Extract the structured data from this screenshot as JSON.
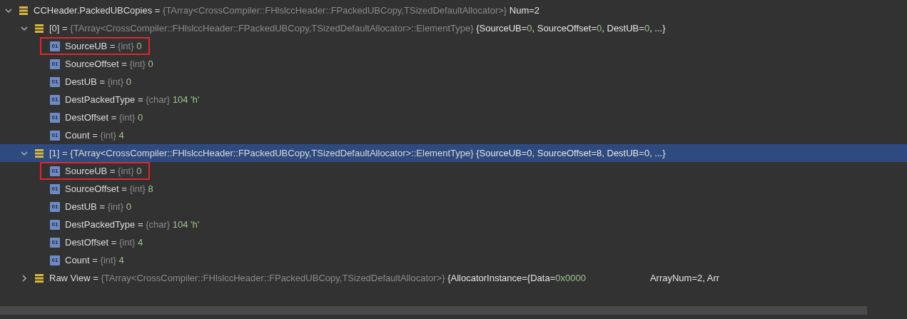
{
  "variables": [
    {
      "kind": "group",
      "name": "CCHeader.PackedUBCopies",
      "equals": "=",
      "type": "{TArray<CrossCompiler::FHlslccHeader::FPackedUBCopy,TSizedDefaultAllocator>}",
      "value": [
        {
          "text": "Num=2",
          "kind": "plain"
        }
      ],
      "expanded": true,
      "selected": false,
      "children": [
        {
          "kind": "group",
          "name": "[0]",
          "equals": "=",
          "type": "{TArray<CrossCompiler::FHlslccHeader::FPackedUBCopy,TSizedDefaultAllocator>::ElementType}",
          "value": [
            {
              "text": "{SourceUB=",
              "kind": "plain"
            },
            {
              "text": "0",
              "kind": "number"
            },
            {
              "text": ", SourceOffset=",
              "kind": "plain"
            },
            {
              "text": "0",
              "kind": "number"
            },
            {
              "text": ", DestUB=",
              "kind": "plain"
            },
            {
              "text": "0",
              "kind": "number"
            },
            {
              "text": ", ...}",
              "kind": "plain"
            }
          ],
          "expanded": true,
          "selected": false,
          "children": [
            {
              "kind": "leaf",
              "badge": "01",
              "name": "SourceUB",
              "equals": "=",
              "type": "{int}",
              "value": [
                {
                  "text": "0",
                  "kind": "number"
                }
              ],
              "selected": false,
              "highlighted": true
            },
            {
              "kind": "leaf",
              "badge": "01",
              "name": "SourceOffset",
              "equals": "=",
              "type": "{int}",
              "value": [
                {
                  "text": "0",
                  "kind": "number"
                }
              ],
              "selected": false,
              "highlighted": false
            },
            {
              "kind": "leaf",
              "badge": "01",
              "name": "DestUB",
              "equals": "=",
              "type": "{int}",
              "value": [
                {
                  "text": "0",
                  "kind": "number"
                }
              ],
              "selected": false,
              "highlighted": false
            },
            {
              "kind": "leaf",
              "badge": "01",
              "name": "DestPackedType",
              "equals": "=",
              "type": "{char}",
              "value": [
                {
                  "text": "104 'h'",
                  "kind": "number"
                }
              ],
              "selected": false,
              "highlighted": false
            },
            {
              "kind": "leaf",
              "badge": "01",
              "name": "DestOffset",
              "equals": "=",
              "type": "{int}",
              "value": [
                {
                  "text": "0",
                  "kind": "number"
                }
              ],
              "selected": false,
              "highlighted": false
            },
            {
              "kind": "leaf",
              "badge": "01",
              "name": "Count",
              "equals": "=",
              "type": "{int}",
              "value": [
                {
                  "text": "4",
                  "kind": "number"
                }
              ],
              "selected": false,
              "highlighted": false
            }
          ]
        },
        {
          "kind": "group",
          "name": "[1]",
          "equals": "=",
          "type": "{TArray<CrossCompiler::FHlslccHeader::FPackedUBCopy,TSizedDefaultAllocator>::ElementType}",
          "value": [
            {
              "text": "{SourceUB=",
              "kind": "plain"
            },
            {
              "text": "0",
              "kind": "number"
            },
            {
              "text": ", SourceOffset=",
              "kind": "plain"
            },
            {
              "text": "8",
              "kind": "number"
            },
            {
              "text": ", DestUB=",
              "kind": "plain"
            },
            {
              "text": "0",
              "kind": "number"
            },
            {
              "text": ", ...}",
              "kind": "plain"
            }
          ],
          "expanded": true,
          "selected": true,
          "children": [
            {
              "kind": "leaf",
              "badge": "01",
              "name": "SourceUB",
              "equals": "=",
              "type": "{int}",
              "value": [
                {
                  "text": "0",
                  "kind": "number"
                }
              ],
              "selected": false,
              "highlighted": true
            },
            {
              "kind": "leaf",
              "badge": "01",
              "name": "SourceOffset",
              "equals": "=",
              "type": "{int}",
              "value": [
                {
                  "text": "8",
                  "kind": "number"
                }
              ],
              "selected": false,
              "highlighted": false
            },
            {
              "kind": "leaf",
              "badge": "01",
              "name": "DestUB",
              "equals": "=",
              "type": "{int}",
              "value": [
                {
                  "text": "0",
                  "kind": "number"
                }
              ],
              "selected": false,
              "highlighted": false
            },
            {
              "kind": "leaf",
              "badge": "01",
              "name": "DestPackedType",
              "equals": "=",
              "type": "{char}",
              "value": [
                {
                  "text": "104 'h'",
                  "kind": "number"
                }
              ],
              "selected": false,
              "highlighted": false
            },
            {
              "kind": "leaf",
              "badge": "01",
              "name": "DestOffset",
              "equals": "=",
              "type": "{int}",
              "value": [
                {
                  "text": "4",
                  "kind": "number"
                }
              ],
              "selected": false,
              "highlighted": false
            },
            {
              "kind": "leaf",
              "badge": "01",
              "name": "Count",
              "equals": "=",
              "type": "{int}",
              "value": [
                {
                  "text": "4",
                  "kind": "number"
                }
              ],
              "selected": false,
              "highlighted": false
            }
          ]
        },
        {
          "kind": "group",
          "name": "Raw View",
          "equals": "=",
          "type": "{TArray<CrossCompiler::FHlslccHeader::FPackedUBCopy,TSizedDefaultAllocator>}",
          "value": [
            {
              "text": "{AllocatorInstance={Data=",
              "kind": "plain"
            },
            {
              "text": "0x0000",
              "kind": "number"
            },
            {
              "text": "ArrayNum=2, Arr",
              "kind": "plain",
              "after_gap": true
            }
          ],
          "expanded": false,
          "selected": false
        }
      ]
    }
  ]
}
